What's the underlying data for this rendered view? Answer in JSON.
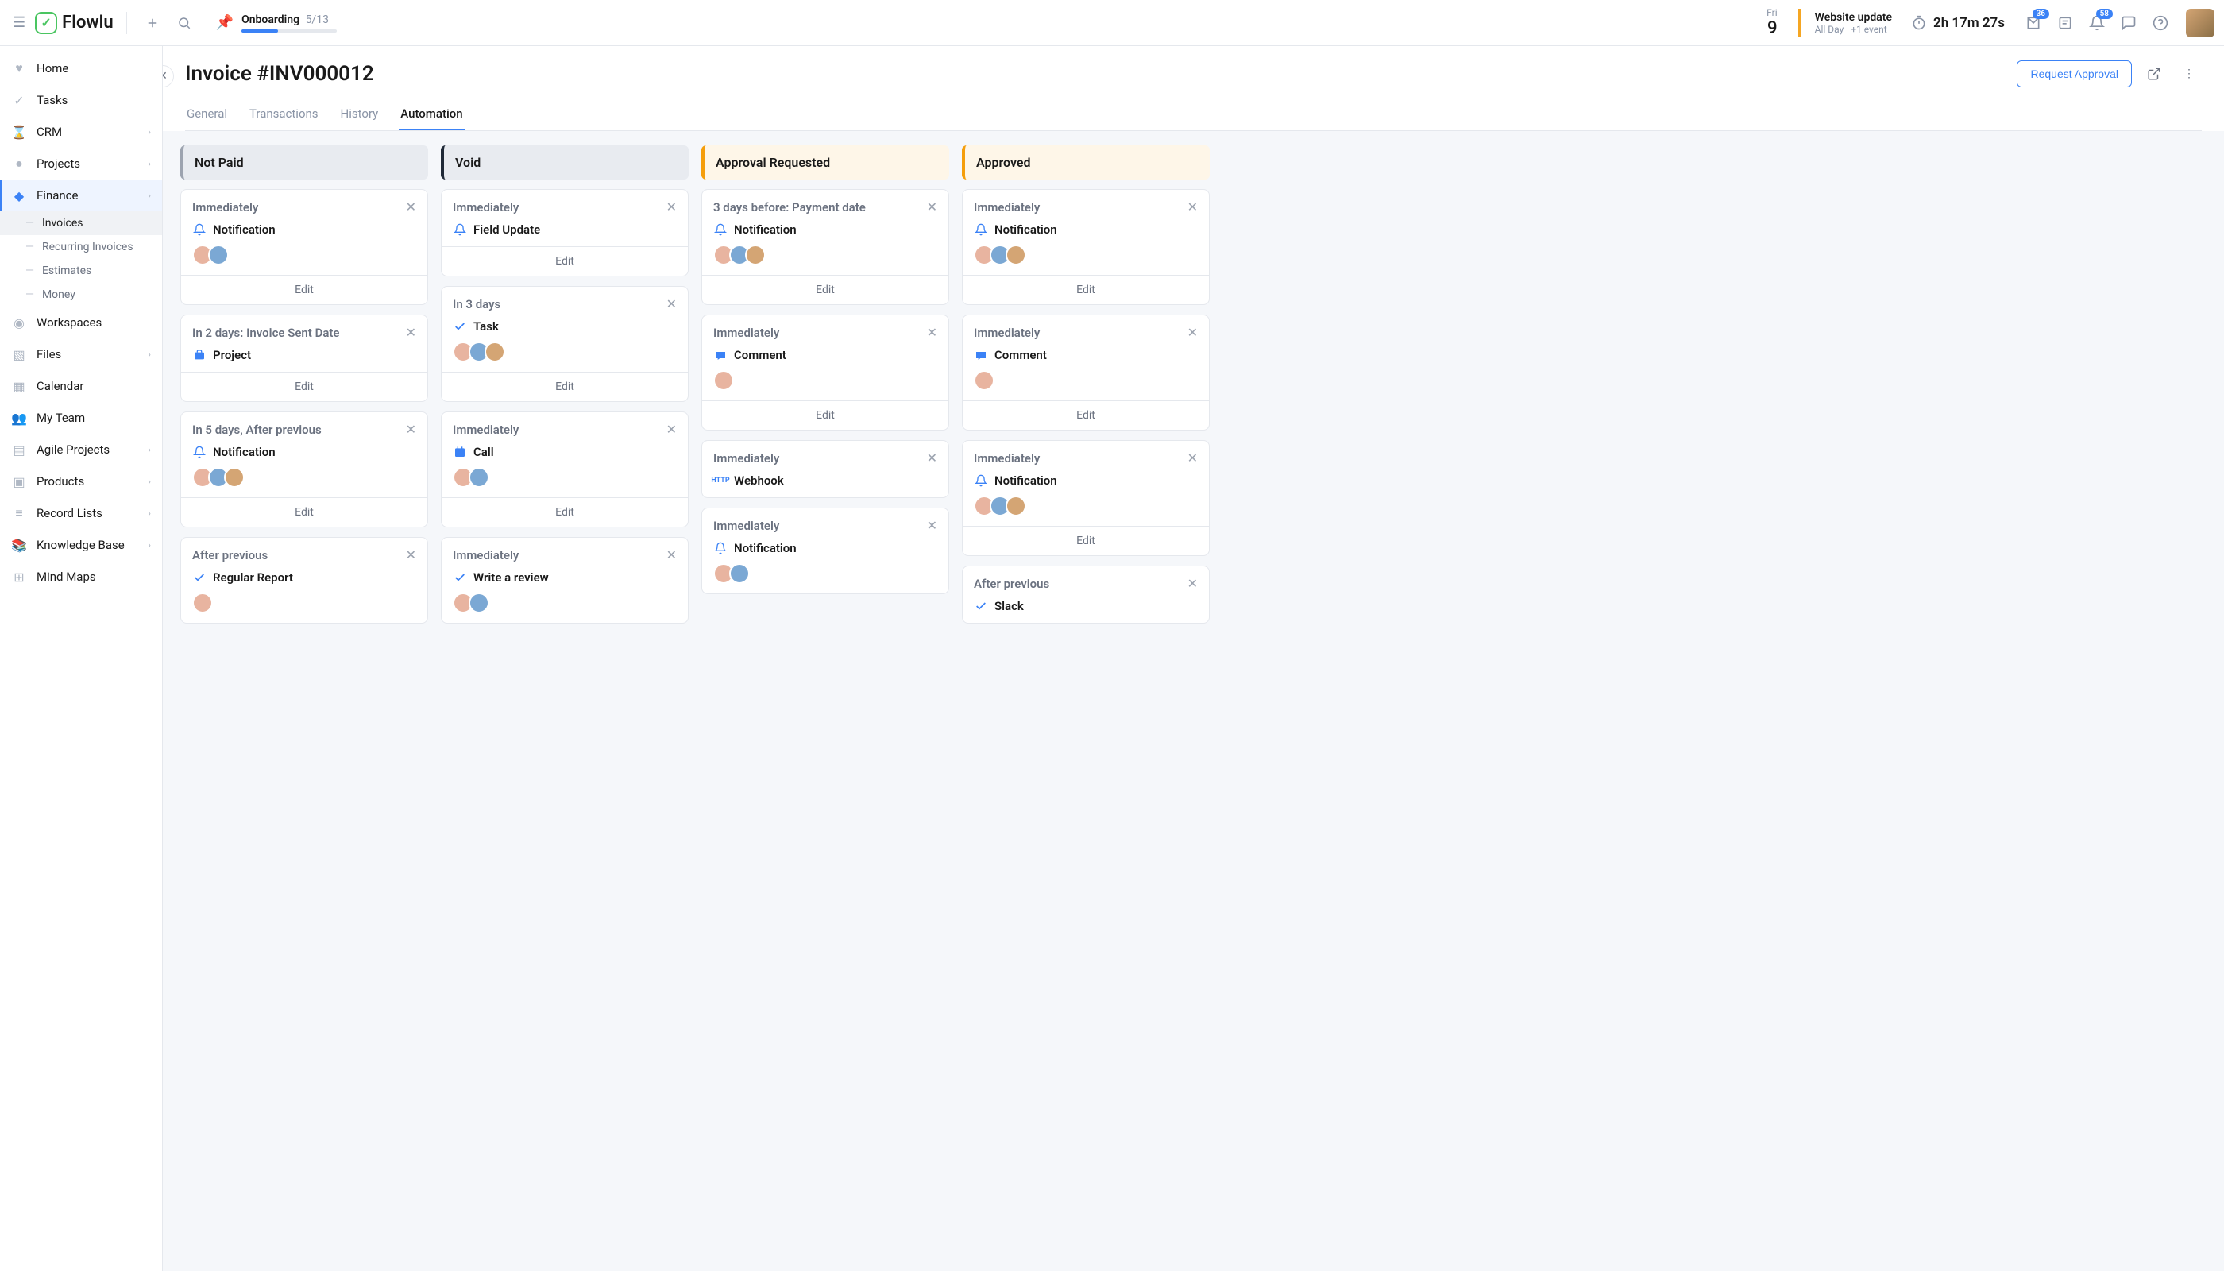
{
  "header": {
    "logo": "Flowlu",
    "onboarding": {
      "label": "Onboarding",
      "count": "5/13",
      "progress_pct": 38
    },
    "date": {
      "day": "Fri",
      "num": "9"
    },
    "event": {
      "title": "Website update",
      "sub": "All Day",
      "more": "+1 event"
    },
    "timer": "2h 17m 27s",
    "badges": {
      "inbox": "36",
      "notifications": "58"
    }
  },
  "sidebar": {
    "items": [
      {
        "label": "Home",
        "icon": "♥",
        "chevron": false
      },
      {
        "label": "Tasks",
        "icon": "✓",
        "chevron": false
      },
      {
        "label": "CRM",
        "icon": "⌛",
        "chevron": true
      },
      {
        "label": "Projects",
        "icon": "●",
        "chevron": true
      },
      {
        "label": "Finance",
        "icon": "◆",
        "chevron": true,
        "active": true
      },
      {
        "label": "Workspaces",
        "icon": "◉",
        "chevron": false
      },
      {
        "label": "Files",
        "icon": "▧",
        "chevron": true
      },
      {
        "label": "Calendar",
        "icon": "▦",
        "chevron": false
      },
      {
        "label": "My Team",
        "icon": "👥",
        "chevron": false
      },
      {
        "label": "Agile Projects",
        "icon": "▤",
        "chevron": true
      },
      {
        "label": "Products",
        "icon": "▣",
        "chevron": true
      },
      {
        "label": "Record Lists",
        "icon": "≡",
        "chevron": true
      },
      {
        "label": "Knowledge Base",
        "icon": "📚",
        "chevron": true
      },
      {
        "label": "Mind Maps",
        "icon": "⊞",
        "chevron": false
      }
    ],
    "subitems": [
      {
        "label": "Invoices",
        "active": true
      },
      {
        "label": "Recurring Invoices"
      },
      {
        "label": "Estimates"
      },
      {
        "label": "Money"
      }
    ]
  },
  "page": {
    "title": "Invoice #INV000012",
    "request_btn": "Request Approval",
    "tabs": [
      {
        "label": "General"
      },
      {
        "label": "Transactions"
      },
      {
        "label": "History"
      },
      {
        "label": "Automation",
        "active": true
      }
    ]
  },
  "columns": [
    {
      "title": "Not Paid",
      "color": "grey",
      "cards": [
        {
          "timing": "Immediately",
          "action": "Notification",
          "icon": "bell",
          "avatars": 2,
          "edit": "Edit"
        },
        {
          "timing": "In 2 days: Invoice Sent Date",
          "action": "Project",
          "icon": "project",
          "avatars": 0,
          "edit": "Edit"
        },
        {
          "timing": "In 5 days, After previous",
          "action": "Notification",
          "icon": "bell",
          "avatars": 3,
          "edit": "Edit"
        },
        {
          "timing": "After previous",
          "action": "Regular Report",
          "icon": "check",
          "avatars": 1
        }
      ]
    },
    {
      "title": "Void",
      "color": "dark",
      "cards": [
        {
          "timing": "Immediately",
          "action": "Field Update",
          "icon": "bell",
          "avatars": 0,
          "edit": "Edit"
        },
        {
          "timing": "In 3 days",
          "action": "Task",
          "icon": "check",
          "avatars": 3,
          "edit": "Edit"
        },
        {
          "timing": "Immediately",
          "action": "Call",
          "icon": "calendar",
          "avatars": 2,
          "edit": "Edit"
        },
        {
          "timing": "Immediately",
          "action": "Write a review",
          "icon": "check",
          "avatars": 2
        }
      ]
    },
    {
      "title": "Approval Requested",
      "color": "orange",
      "cards": [
        {
          "timing": "3 days before: Payment date",
          "action": "Notification",
          "icon": "bell",
          "avatars": 3,
          "edit": "Edit"
        },
        {
          "timing": "Immediately",
          "action": "Comment",
          "icon": "comment",
          "avatars": 1,
          "edit": "Edit"
        },
        {
          "timing": "Immediately",
          "action": "Webhook",
          "icon": "http",
          "avatars": 0
        },
        {
          "timing": "Immediately",
          "action": "Notification",
          "icon": "bell",
          "avatars": 2
        }
      ]
    },
    {
      "title": "Approved",
      "color": "orange",
      "cards": [
        {
          "timing": "Immediately",
          "action": "Notification",
          "icon": "bell",
          "avatars": 3,
          "edit": "Edit"
        },
        {
          "timing": "Immediately",
          "action": "Comment",
          "icon": "comment",
          "avatars": 1,
          "edit": "Edit"
        },
        {
          "timing": "Immediately",
          "action": "Notification",
          "icon": "bell",
          "avatars": 3,
          "edit": "Edit"
        },
        {
          "timing": "After previous",
          "action": "Slack",
          "icon": "check",
          "avatars": 0
        }
      ]
    }
  ]
}
